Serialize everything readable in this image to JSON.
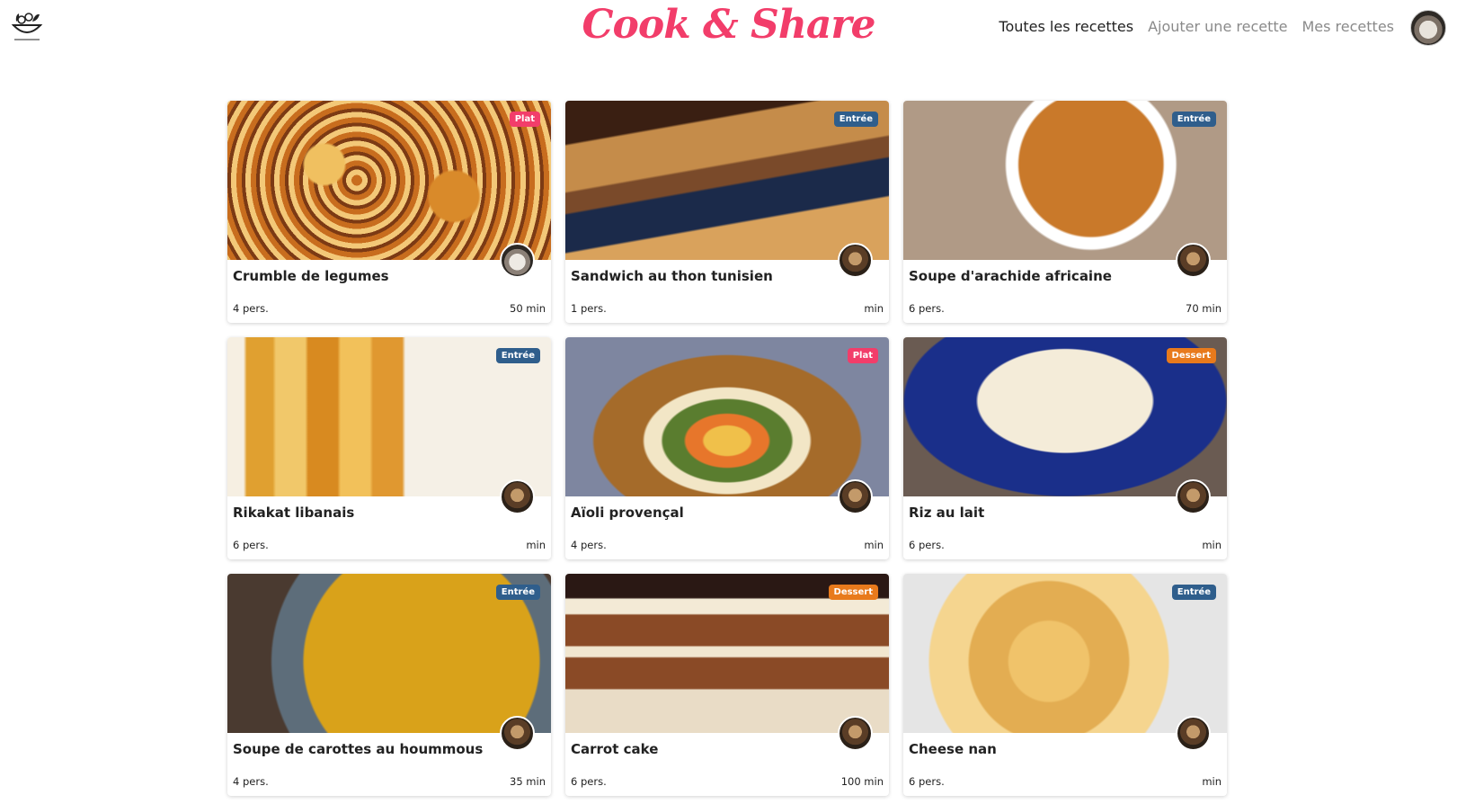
{
  "header": {
    "brand": "Cook & Share",
    "nav": [
      {
        "label": "Toutes les recettes",
        "active": true
      },
      {
        "label": "Ajouter une recette",
        "active": false
      },
      {
        "label": "Mes recettes",
        "active": false
      }
    ]
  },
  "recipes": [
    {
      "title": "Crumble de legumes",
      "persons": "4 pers.",
      "time": "50 min",
      "category": "Plat"
    },
    {
      "title": "Sandwich au thon tunisien",
      "persons": "1 pers.",
      "time": "min",
      "category": "Entrée"
    },
    {
      "title": "Soupe d'arachide africaine",
      "persons": "6 pers.",
      "time": "70 min",
      "category": "Entrée"
    },
    {
      "title": "Rikakat libanais",
      "persons": "6 pers.",
      "time": "min",
      "category": "Entrée"
    },
    {
      "title": "Aïoli provençal",
      "persons": "4 pers.",
      "time": "min",
      "category": "Plat"
    },
    {
      "title": "Riz au lait",
      "persons": "6 pers.",
      "time": "min",
      "category": "Dessert"
    },
    {
      "title": "Soupe de carottes au hoummous",
      "persons": "4 pers.",
      "time": "35 min",
      "category": "Entrée"
    },
    {
      "title": "Carrot cake",
      "persons": "6 pers.",
      "time": "100 min",
      "category": "Dessert"
    },
    {
      "title": "Cheese nan",
      "persons": "6 pers.",
      "time": "min",
      "category": "Entrée"
    }
  ],
  "colors": {
    "brand": "#f23d6a",
    "plat": "#f23d6a",
    "entree": "#2f5e8c",
    "dessert": "#e87a1c"
  }
}
